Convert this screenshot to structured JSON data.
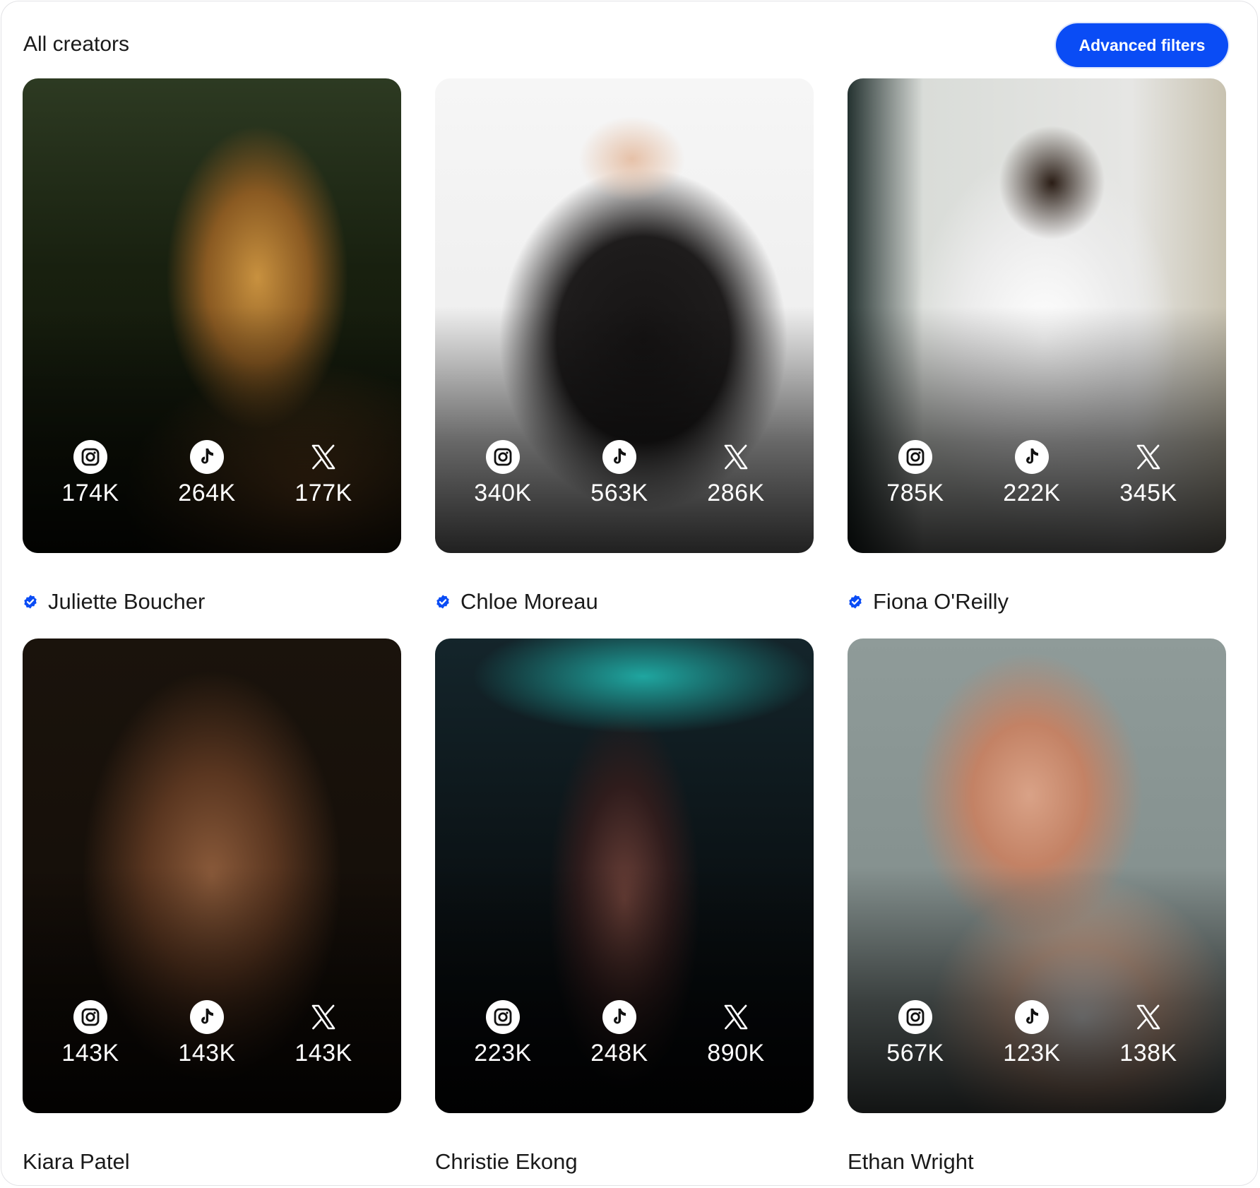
{
  "header": {
    "title": "All creators",
    "advanced_filters_label": "Advanced filters"
  },
  "creators": [
    {
      "name": "Juliette Boucher",
      "verified": true,
      "instagram": "174K",
      "tiktok": "264K",
      "x": "177K"
    },
    {
      "name": "Chloe Moreau",
      "verified": true,
      "instagram": "340K",
      "tiktok": "563K",
      "x": "286K"
    },
    {
      "name": "Fiona O'Reilly",
      "verified": true,
      "instagram": "785K",
      "tiktok": "222K",
      "x": "345K"
    },
    {
      "name": "Kiara Patel",
      "verified": false,
      "instagram": "143K",
      "tiktok": "143K",
      "x": "143K"
    },
    {
      "name": "Christie Ekong",
      "verified": false,
      "instagram": "223K",
      "tiktok": "248K",
      "x": "890K"
    },
    {
      "name": "Ethan Wright",
      "verified": false,
      "instagram": "567K",
      "tiktok": "123K",
      "x": "138K"
    }
  ],
  "icons": {
    "instagram": "instagram-icon",
    "tiktok": "tiktok-icon",
    "x": "x-icon",
    "verified": "verified-badge-icon"
  },
  "colors": {
    "accent": "#0a4cf5",
    "verified": "#0a4cf5"
  }
}
